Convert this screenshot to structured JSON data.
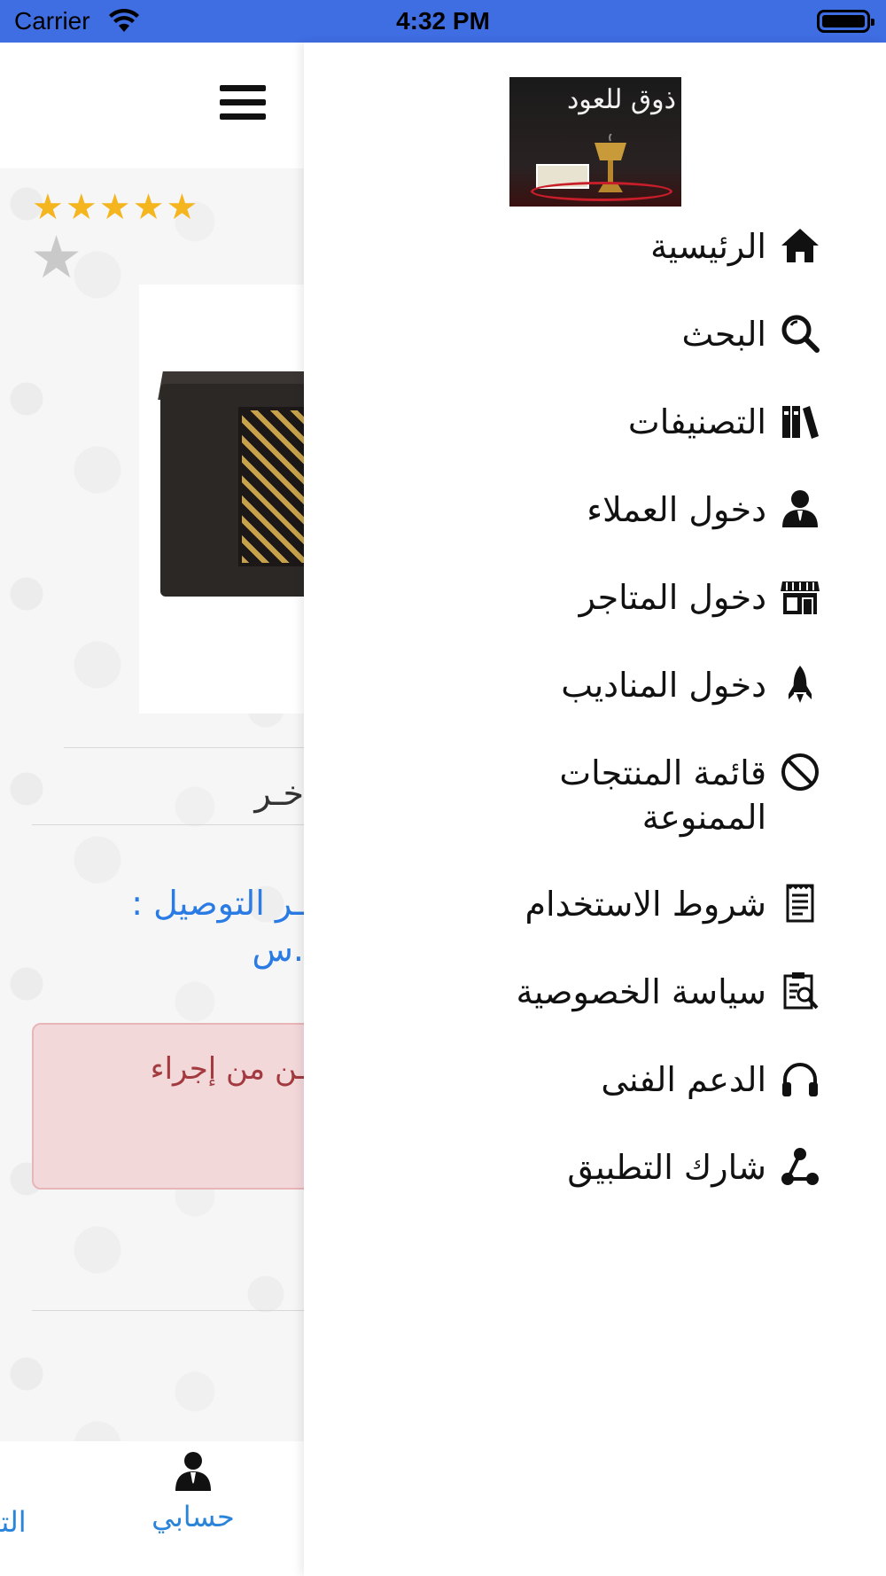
{
  "status_bar": {
    "carrier": "Carrier",
    "time": "4:32 PM"
  },
  "background_page": {
    "rating_stars": 5,
    "partial_title": "خـر",
    "delivery_line1": "ـر التوصيل :",
    "delivery_line2": ".س",
    "alert_text": "مـن من إجراء",
    "tab_account_label": "حسابي",
    "tab_partial_label": "التـ"
  },
  "drawer": {
    "logo_text": "ذوق للعود",
    "menu": {
      "home": "الرئيسية",
      "search": "البحث",
      "categories": "التصنيفات",
      "customer_login": "دخول العملاء",
      "stores_login": "دخول المتاجر",
      "delegates_login": "دخول المناديب",
      "banned_products": "قائمة المنتجات الممنوعة",
      "terms": "شروط الاستخدام",
      "privacy": "سياسة الخصوصية",
      "support": "الدعم الفنى",
      "share": "شارك التطبيق"
    }
  },
  "colors": {
    "status_bar": "#3f6de2",
    "link_blue": "#2a7be4",
    "star_gold": "#f4b51f",
    "alert_bg": "#f3d8da",
    "alert_text": "#a23a3f"
  },
  "icons": [
    "wifi-icon",
    "battery-icon",
    "hamburger-icon",
    "star-icon",
    "home-icon",
    "search-icon",
    "books-icon",
    "person-icon",
    "store-icon",
    "rocket-icon",
    "ban-icon",
    "document-icon",
    "clipboard-search-icon",
    "headphones-icon",
    "share-icon"
  ]
}
